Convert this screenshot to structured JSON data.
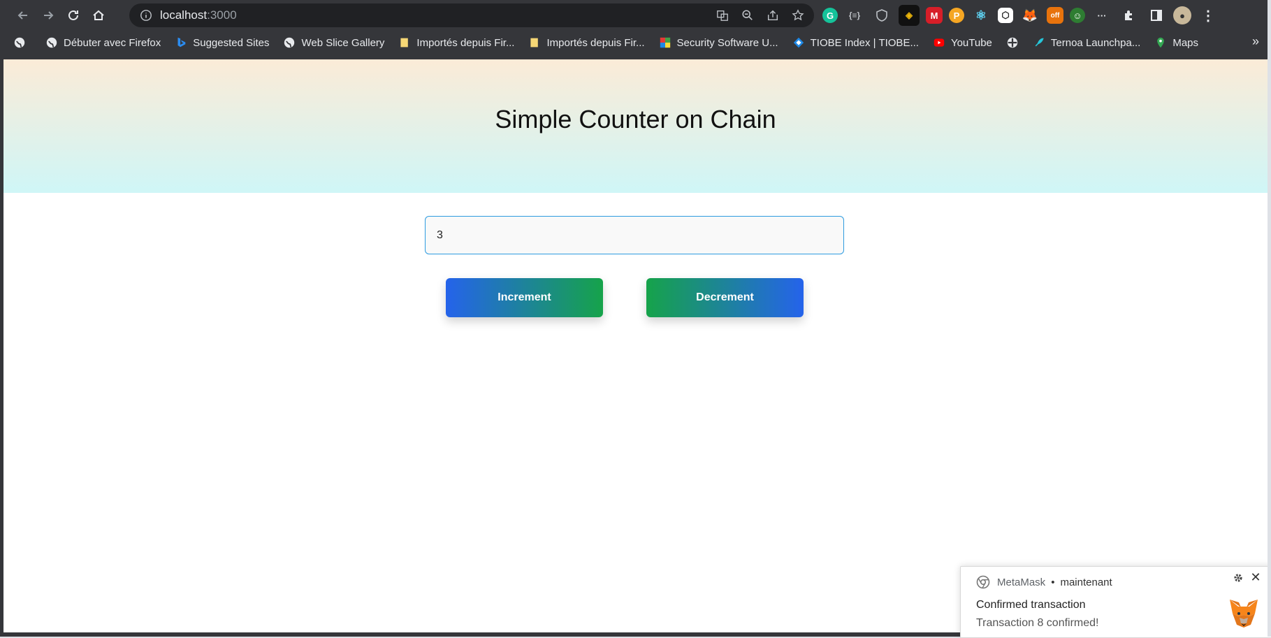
{
  "browser": {
    "url_host": "localhost",
    "url_port": ":3000"
  },
  "bookmarks": [
    {
      "label": "",
      "icon": "globe-icon"
    },
    {
      "label": "Débuter avec Firefox",
      "icon": "globe-icon"
    },
    {
      "label": "Suggested Sites",
      "icon": "bing-icon"
    },
    {
      "label": "Web Slice Gallery",
      "icon": "globe-icon"
    },
    {
      "label": "Importés depuis Fir...",
      "icon": "folder-icon"
    },
    {
      "label": "Importés depuis Fir...",
      "icon": "folder-icon"
    },
    {
      "label": "Security Software U...",
      "icon": "security-icon"
    },
    {
      "label": "TIOBE Index | TIOBE...",
      "icon": "tiobe-icon"
    },
    {
      "label": "YouTube",
      "icon": "youtube-icon"
    },
    {
      "label": "",
      "icon": "ternoa-icon"
    },
    {
      "label": "Ternoa Launchpa...",
      "icon": "rocket-icon"
    },
    {
      "label": "Maps",
      "icon": "maps-icon"
    }
  ],
  "page": {
    "title": "Simple Counter on Chain",
    "counter_value": "3",
    "increment_label": "Increment",
    "decrement_label": "Decrement"
  },
  "notification": {
    "app": "MetaMask",
    "separator": "•",
    "time": "maintenant",
    "title": "Confirmed transaction",
    "message": "Transaction 8 confirmed!",
    "close_glyph": "✕"
  },
  "colors": {
    "increment_gradient": [
      "#2563eb",
      "#16a34a"
    ],
    "decrement_gradient": [
      "#16a34a",
      "#2563eb"
    ],
    "hero_gradient": [
      "#fbebd7",
      "#cff6f7"
    ]
  }
}
